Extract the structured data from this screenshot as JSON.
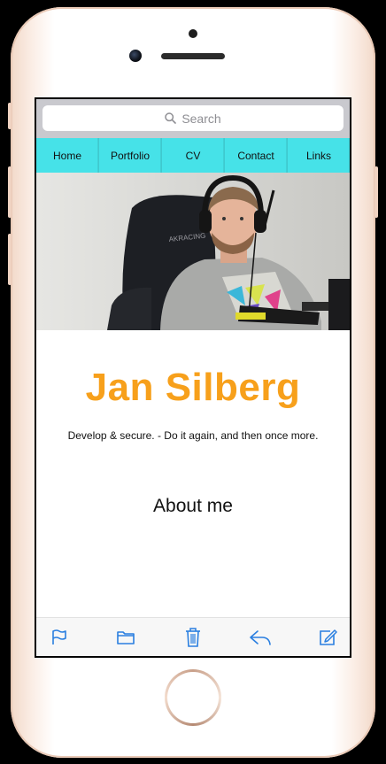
{
  "search": {
    "placeholder": "Search"
  },
  "nav": {
    "items": [
      "Home",
      "Portfolio",
      "CV",
      "Contact",
      "Links"
    ]
  },
  "profile": {
    "name": "Jan Silberg",
    "tagline": "Develop & secure. - Do it again, and then once more.",
    "section_title": "About me"
  },
  "toolbar": {
    "icons": [
      "flag-icon",
      "folder-icon",
      "trash-icon",
      "reply-icon",
      "compose-icon"
    ]
  },
  "colors": {
    "accent_name": "#f7a01b",
    "nav_bg": "#46e2e8",
    "toolbar_icon": "#2a7fe0"
  }
}
